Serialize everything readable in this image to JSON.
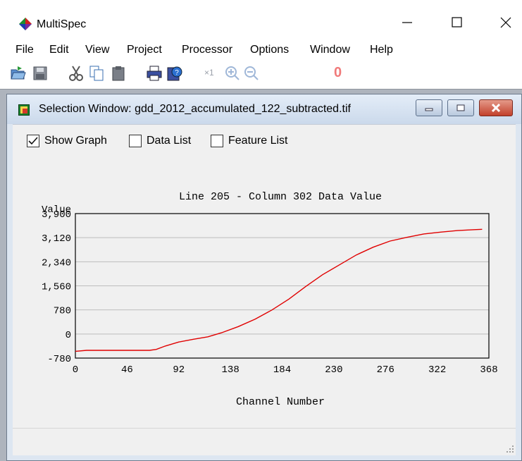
{
  "app": {
    "title": "MultiSpec"
  },
  "menu": [
    "File",
    "Edit",
    "View",
    "Project",
    "Processor",
    "Options",
    "Window",
    "Help"
  ],
  "toolbar": {
    "icons": [
      "open-icon",
      "save-icon",
      "cut-icon",
      "copy-icon",
      "paste-icon",
      "print-icon",
      "help-icon",
      "zoom-x1-icon",
      "zoom-in-icon",
      "zoom-out-icon",
      "zoom-level-icon"
    ],
    "zoom_x1_label": "×1",
    "zoom_level_label": "0"
  },
  "child_window": {
    "title": "Selection Window: gdd_2012_accumulated_122_subtracted.tif"
  },
  "options": {
    "show_graph": {
      "label": "Show Graph",
      "checked": true
    },
    "data_list": {
      "label": "Data List",
      "checked": false
    },
    "feature_list": {
      "label": "Feature List",
      "checked": false
    }
  },
  "chart_data": {
    "type": "line",
    "title": "Line 205 - Column 302 Data Value",
    "xlabel": "Channel Number",
    "ylabel": "Value",
    "xlim": [
      0,
      368
    ],
    "ylim": [
      -780,
      3900
    ],
    "x_ticks": [
      "0",
      "46",
      "92",
      "138",
      "184",
      "230",
      "276",
      "322",
      "368"
    ],
    "y_ticks": [
      "3,900",
      "3,120",
      "2,340",
      "1,560",
      "780",
      "0",
      "-780"
    ],
    "y_tick_values": [
      3900,
      3120,
      2340,
      1560,
      780,
      0,
      -780
    ],
    "grid": true,
    "line_color": "#e00000",
    "series": [
      {
        "x": [
          0,
          10,
          30,
          50,
          66,
          72,
          80,
          92,
          105,
          118,
          130,
          145,
          160,
          175,
          190,
          205,
          220,
          235,
          250,
          265,
          280,
          295,
          310,
          325,
          340,
          355,
          362
        ],
        "values": [
          -560,
          -530,
          -530,
          -530,
          -530,
          -500,
          -390,
          -260,
          -170,
          -90,
          40,
          240,
          480,
          780,
          1130,
          1540,
          1920,
          2240,
          2560,
          2810,
          3010,
          3130,
          3240,
          3300,
          3350,
          3380,
          3390
        ]
      }
    ]
  }
}
